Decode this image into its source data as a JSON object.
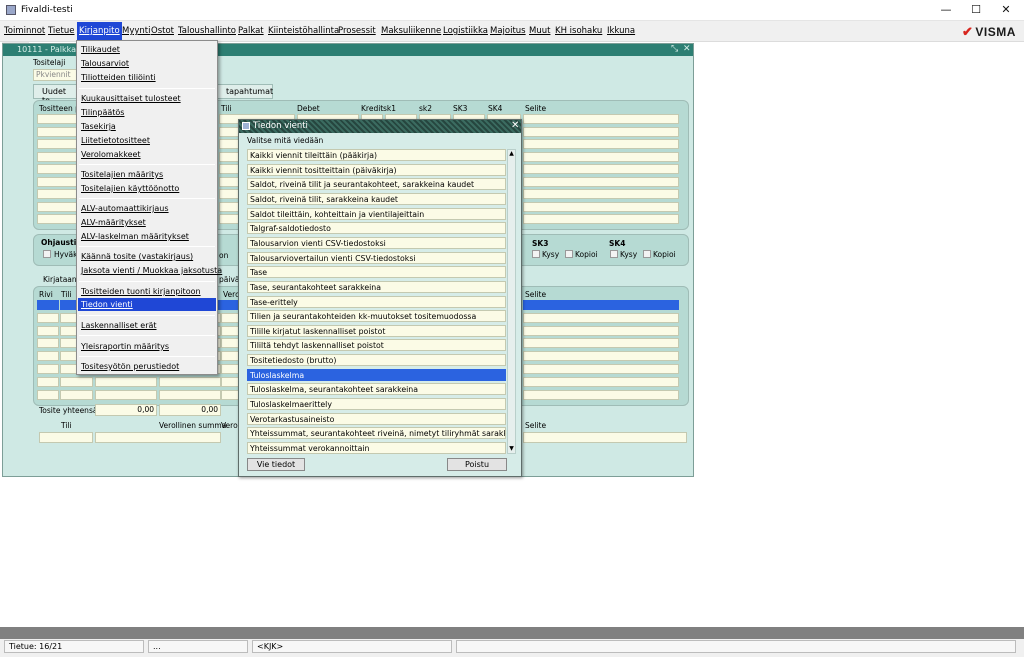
{
  "window": {
    "title": "Fivaldi-testi",
    "minimize": "—",
    "maximize": "☐",
    "close": "✕"
  },
  "menubar": [
    "Toiminnot",
    "Tietue",
    "Kirjanpito",
    "Myynti",
    "Ostot",
    "Taloushallinto",
    "Palkat",
    "Kiinteistöhallinta",
    "Prosessit",
    "Maksuliikenne",
    "Logistiikka",
    "Majoitus",
    "Muut",
    "KH isohaku",
    "Ikkuna"
  ],
  "brand": {
    "name": "VISMA",
    "color": "#d7261e"
  },
  "form": {
    "title": "10111 - Palkka",
    "tositelaji_label": "Tositelaji",
    "pkviennit": "Pkviennit",
    "tab_uudet": "Uudet to",
    "tab_tapahtumat": "tapahtumat",
    "grid1_headers": [
      "Tositteen p",
      "Tili",
      "Debet",
      "Kredit",
      "sk1",
      "sk2",
      "SK3",
      "SK4",
      "Selite"
    ],
    "ohjaus_label": "Ohjaustie",
    "hyvaksy": "Hyväk",
    "sk3": "SK3",
    "sk4": "SK4",
    "kysy": "Kysy",
    "kopioi": "Kopioi",
    "on_label": "on",
    "kirjataan": "Kirjataan t",
    "paivam": "päivän",
    "grid2_headers": [
      "Rivi",
      "Tili",
      "Verc",
      "Selite"
    ],
    "tosite_yhteensa": "Tosite yhteensä",
    "sum1": "0,00",
    "sum2": "0,00",
    "bottom_tili": "Tili",
    "verollinen_summa": "Verollinen summa",
    "vero": "Vero",
    "bottom_selite": "Selite"
  },
  "dropdown": [
    "Tilikaudet",
    "Talousarviot",
    "Tiliotteiden tiliöinti",
    "Kuukausittaiset tulosteet",
    "Tilinpäätös",
    "Tasekirja",
    "Liitetietotositteet",
    "Verolomakkeet",
    "Tositelajien määritys",
    "Tositelajien käyttöönotto",
    "ALV-automaattikirjaus",
    "ALV-määritykset",
    "ALV-laskelman määritykset",
    "Käännä tosite (vastakirjaus)",
    "Jaksota vienti / Muokkaa jaksotusta",
    "Tositteiden tuonti kirjanpitoon",
    "Tiedon vienti",
    "Laskennalliset erät",
    "Yleisraportin määritys",
    "Tositesyötön perustiedot"
  ],
  "dropdown_selected": "Tiedon vienti",
  "dialog": {
    "title": "Tiedon vienti",
    "prompt": "Valitse mitä viedään",
    "items": [
      "Kaikki viennit tileittäin (pääkirja)",
      "Kaikki viennit tositteittain (päiväkirja)",
      "Saldot, riveinä tilit ja seurantakohteet, sarakkeina kaudet",
      "Saldot, riveinä tilit, sarakkeina kaudet",
      "Saldot tileittäin, kohteittain ja vientilajeittain",
      "Talgraf-saldotiedosto",
      "Talousarvion vienti CSV-tiedostoksi",
      "Talousarviovertailun vienti CSV-tiedostoksi",
      "Tase",
      "Tase, seurantakohteet sarakkeina",
      "Tase-erittely",
      "Tilien ja seurantakohteiden kk-muutokset tositemuodossa",
      "Tilille kirjatut laskennalliset poistot",
      "Tililtä tehdyt laskennalliset poistot",
      "Tositetiedosto (brutto)",
      "Tuloslaskelma",
      "Tuloslaskelma, seurantakohteet sarakkeina",
      "Tuloslaskelmaerittely",
      "Verotarkastusaineisto",
      "Yhteissummat, seurantakohteet riveinä, nimetyt tiliryhmät sarakkeina",
      "Yhteissummat verokannoittain"
    ],
    "selected": "Tuloslaskelma",
    "btn_export": "Vie tiedot",
    "btn_close": "Poistu"
  },
  "status": {
    "record": "Tietue: 16/21",
    "middle": "...",
    "kjk": "<KJK>"
  },
  "colors": {
    "accent": "#1f47d6",
    "form_bg": "#cfe9e4",
    "header_teal": "#2d7f73"
  }
}
